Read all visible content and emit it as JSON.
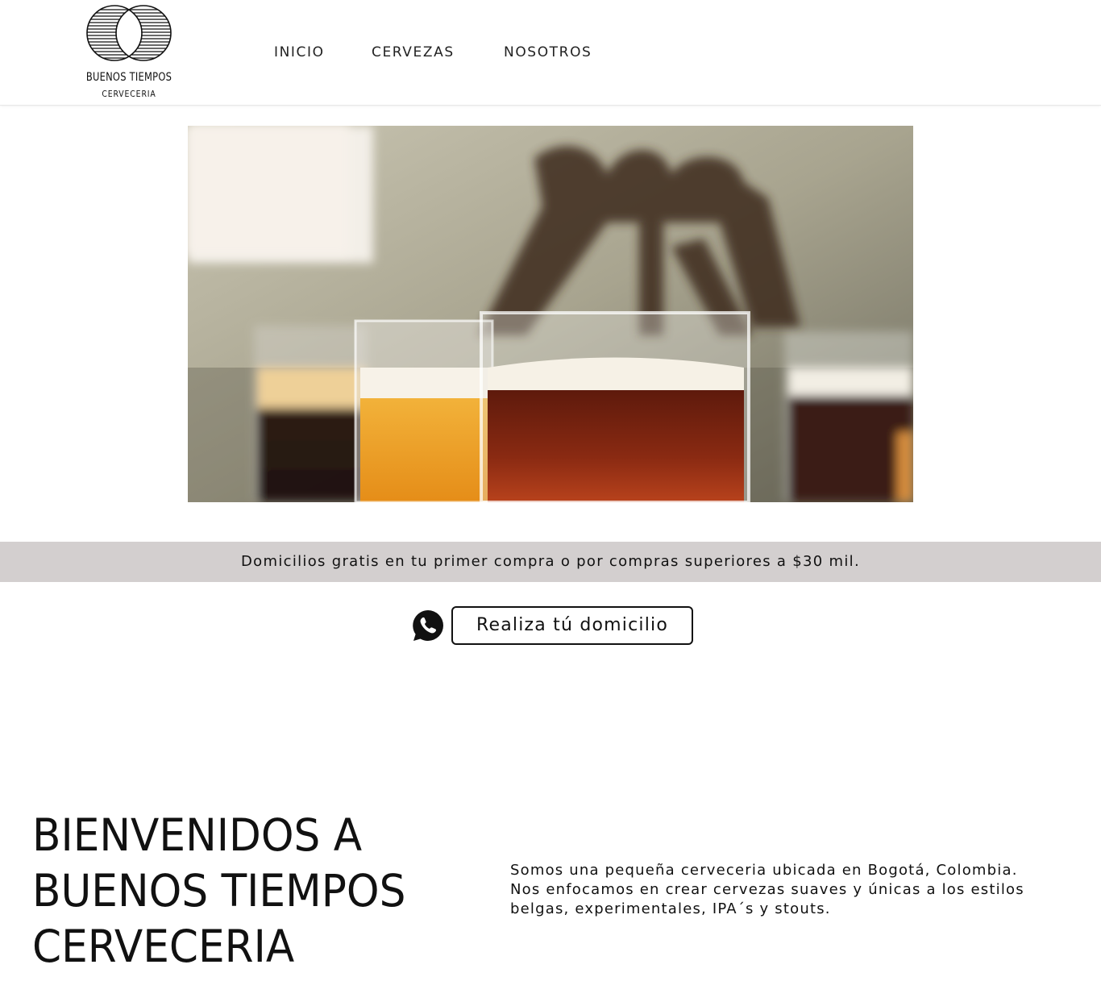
{
  "brand": {
    "name": "BUENOS TIEMPOS",
    "subtitle": "CERVECERIA"
  },
  "nav": {
    "items": [
      {
        "label": "INICIO"
      },
      {
        "label": "CERVEZAS"
      },
      {
        "label": "NOSOTROS"
      }
    ]
  },
  "hero": {
    "icon": "beer-glasses-photo"
  },
  "banner": {
    "text": "Domicilios gratis en tu primer compra o por compras superiores a $30 mil."
  },
  "cta": {
    "icon": "whatsapp-icon",
    "label": "Realiza tú domicilio"
  },
  "welcome": {
    "lines": [
      "BIENVENIDOS A",
      "BUENOS TIEMPOS",
      "CERVECERIA"
    ]
  },
  "about": {
    "lines": [
      "Somos una pequeña cerveceria ubicada en Bogotá, Colombia.",
      "Nos enfocamos en crear cervezas suaves y únicas a los estilos",
      "belgas, experimentales, IPA´s y stouts."
    ]
  },
  "colors": {
    "banner_bg": "#d3cfcf",
    "text": "#111111",
    "background": "#ffffff"
  }
}
